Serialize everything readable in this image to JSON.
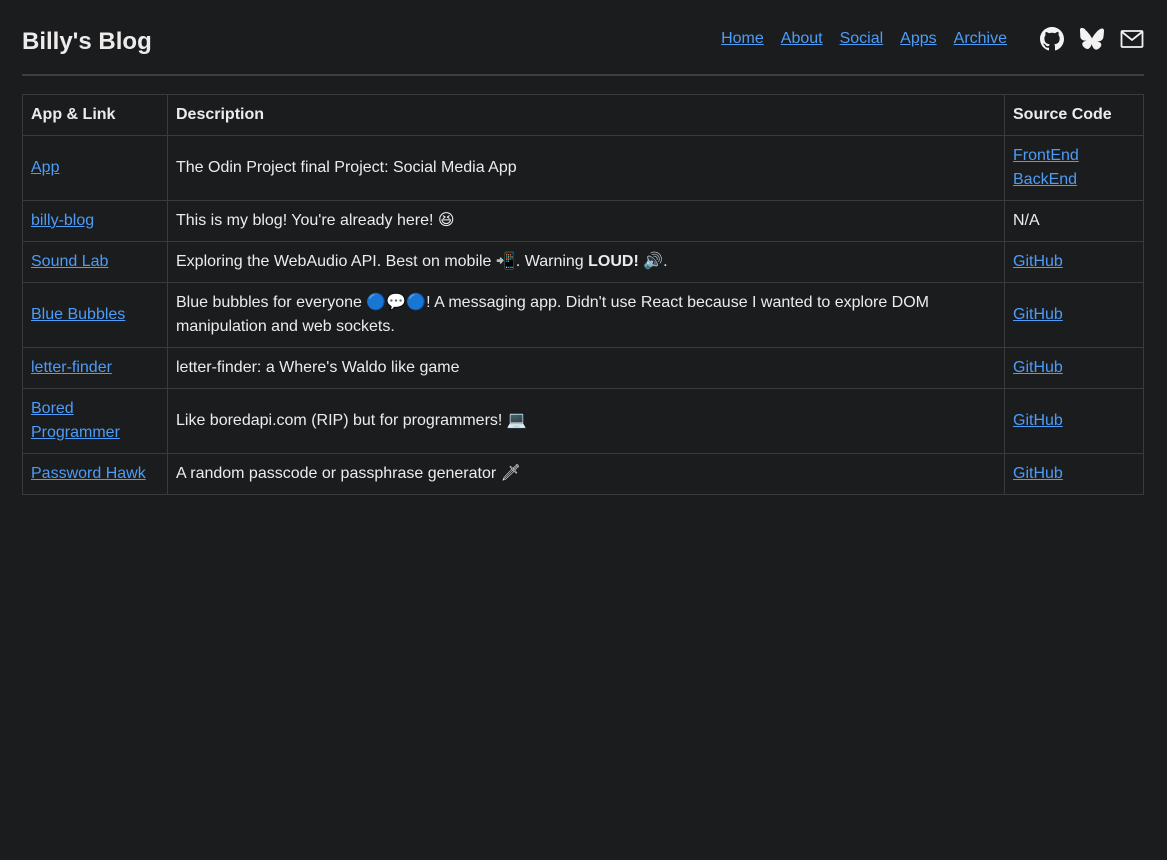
{
  "site": {
    "title": "Billy's Blog"
  },
  "nav": {
    "links": [
      "Home",
      "About",
      "Social",
      "Apps",
      "Archive"
    ],
    "icons": [
      "github-icon",
      "bluesky-icon",
      "mail-icon"
    ]
  },
  "table": {
    "headers": {
      "app": "App & Link",
      "description": "Description",
      "source": "Source Code"
    },
    "rows": [
      {
        "app": "App",
        "description": "The Odin Project final Project: Social Media App",
        "source": [
          "FrontEnd",
          "BackEnd"
        ]
      },
      {
        "app": "billy-blog",
        "description": "This is my blog! You're already here! 😆",
        "source_text": "N/A"
      },
      {
        "app": "Sound Lab",
        "description_pre": "Exploring the WebAudio API. Best on mobile 📲. Warning ",
        "description_bold": "LOUD!",
        "description_post": " 🔊.",
        "source": [
          "GitHub"
        ]
      },
      {
        "app": "Blue Bubbles",
        "description": "Blue bubbles for everyone 🔵💬🔵! A messaging app. Didn't use React because I wanted to explore DOM manipulation and web sockets.",
        "source": [
          "GitHub"
        ]
      },
      {
        "app": "letter-finder",
        "description": "letter-finder: a Where's Waldo like game",
        "source": [
          "GitHub"
        ]
      },
      {
        "app": "Bored Programmer",
        "description": "Like boredapi.com (RIP) but for programmers! 💻",
        "source": [
          "GitHub"
        ]
      },
      {
        "app": "Password Hawk",
        "description": "A random passcode or passphrase generator 🗡",
        "source": [
          "GitHub"
        ]
      }
    ]
  }
}
